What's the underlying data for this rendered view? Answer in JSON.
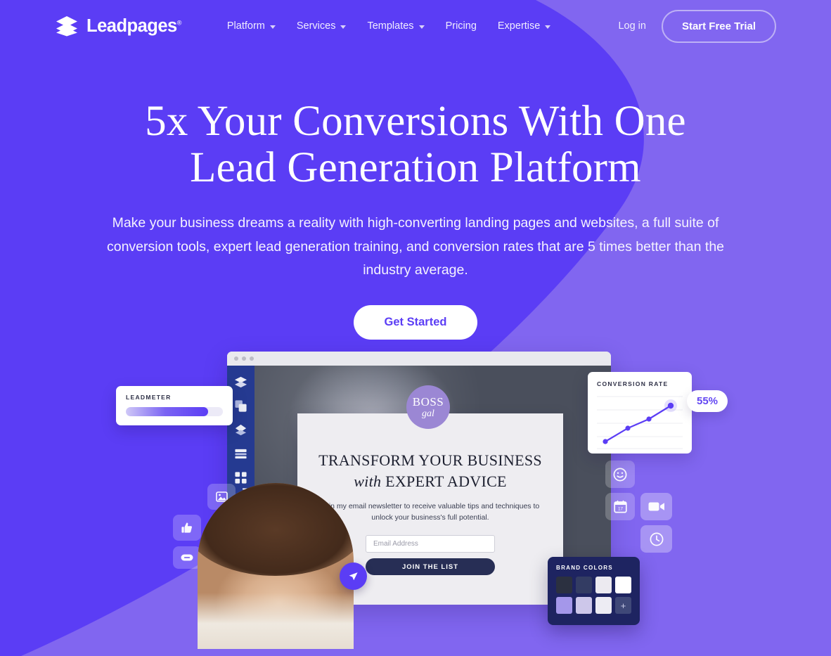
{
  "brand": {
    "name": "Leadpages",
    "registered": "®",
    "logo_icon": "stacked-layers-icon",
    "primary_color": "#5b3df5",
    "secondary_color": "#8166f0"
  },
  "nav": {
    "items": [
      {
        "label": "Platform",
        "has_dropdown": true
      },
      {
        "label": "Services",
        "has_dropdown": true
      },
      {
        "label": "Templates",
        "has_dropdown": true
      },
      {
        "label": "Pricing",
        "has_dropdown": false
      },
      {
        "label": "Expertise",
        "has_dropdown": true
      }
    ],
    "login_label": "Log in",
    "trial_label": "Start Free Trial"
  },
  "hero": {
    "title_line1": "5x Your Conversions With One",
    "title_line2": "Lead Generation Platform",
    "subtitle": "Make your business dreams a reality with high-converting landing pages and websites, a full suite of conversion tools, expert lead generation training, and conversion rates that are 5 times better than the industry average.",
    "cta_label": "Get Started"
  },
  "illustration": {
    "leadmeter": {
      "title": "LEADMETER",
      "progress_percent": 85
    },
    "conversion_card": {
      "title": "CONVERSION RATE",
      "badge_value": "55%"
    },
    "brand_colors": {
      "title": "BRAND COLORS",
      "add_label": "+",
      "swatches": [
        "#2b3040",
        "#333c63",
        "#eceaf0",
        "#ffffff",
        "#a497ea",
        "#cdc7ea",
        "#edecf3",
        "#3f4878"
      ]
    },
    "landing_page": {
      "logo_line1": "BOSS",
      "logo_line2": "gal",
      "heading_line1": "TRANSFORM YOUR BUSINESS",
      "heading_italic": "with",
      "heading_line2": "EXPERT ADVICE",
      "body_line1": "Join my email newsletter to receive valuable tips and techniques",
      "body_line2": "to unlock your business's full potential.",
      "email_placeholder": "Email Address",
      "submit_label": "JOIN THE LIST"
    },
    "editor_rail_icons": [
      "layers-icon",
      "duplicate-icon",
      "sections-icon",
      "rows-icon",
      "widgets-icon",
      "brush-icon",
      "gear-icon"
    ],
    "floating_tiles": [
      {
        "icon": "image-icon"
      },
      {
        "icon": "list-icon"
      },
      {
        "icon": "thumbs-up-icon"
      },
      {
        "icon": "button-icon"
      },
      {
        "icon": "smiley-icon"
      },
      {
        "icon": "calendar-icon"
      },
      {
        "icon": "video-camera-icon"
      },
      {
        "icon": "clock-icon"
      }
    ],
    "cursor_icon": "cursor-pointer-icon",
    "browser_dots": 3
  },
  "chart_data": {
    "type": "line",
    "title": "CONVERSION RATE",
    "x": [
      0,
      1,
      2,
      3
    ],
    "values": [
      12,
      34,
      47,
      72
    ],
    "ylim": [
      0,
      100
    ],
    "xlabel": "",
    "ylabel": "",
    "grid": true,
    "legend": "none",
    "annotation": "55%",
    "line_color": "#5b3df5",
    "point_color": "#5b3df5"
  }
}
